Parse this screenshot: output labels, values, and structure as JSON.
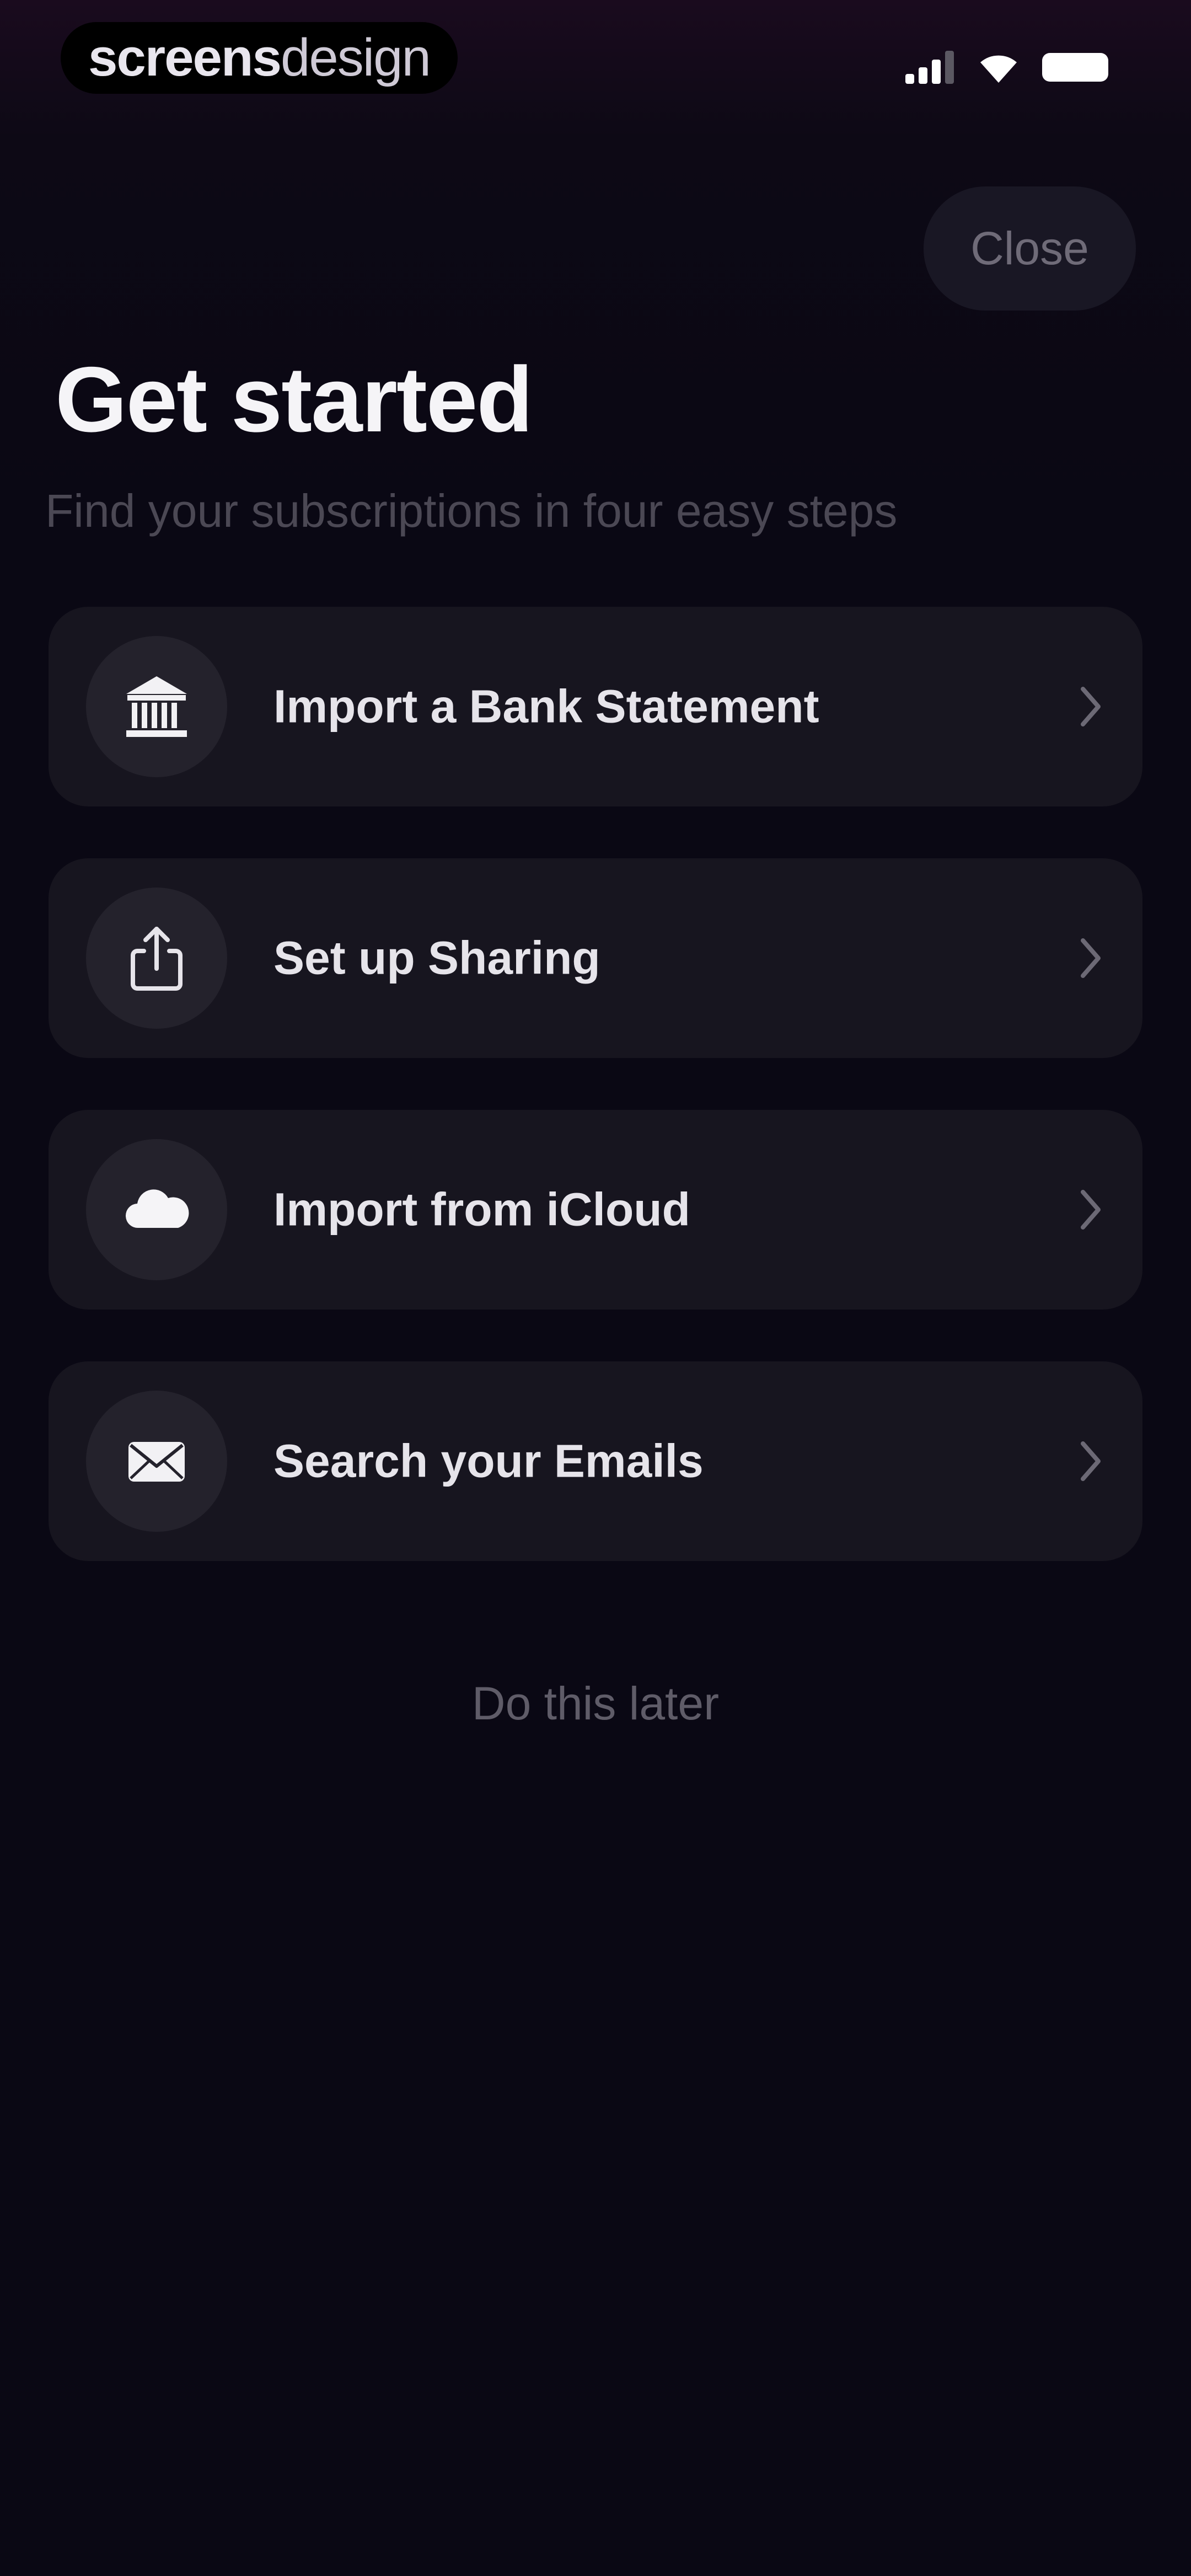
{
  "status_bar": {
    "brand_bold": "screens",
    "brand_light": "design",
    "icons": [
      "signal-icon",
      "wifi-icon",
      "battery-icon"
    ]
  },
  "header": {
    "close_label": "Close",
    "title": "Get started",
    "subtitle": "Find your subscriptions in four easy steps"
  },
  "options": [
    {
      "label": "Import a Bank Statement",
      "icon": "bank-icon"
    },
    {
      "label": "Set up Sharing",
      "icon": "share-icon"
    },
    {
      "label": "Import from iCloud",
      "icon": "cloud-icon"
    },
    {
      "label": "Search your Emails",
      "icon": "mail-icon"
    }
  ],
  "footer": {
    "later_label": "Do this later"
  },
  "colors": {
    "background": "#0a0814",
    "card": "#17151f",
    "icon_circle": "#24222c",
    "close_bg": "#191724",
    "muted_text": "#4b4854"
  }
}
